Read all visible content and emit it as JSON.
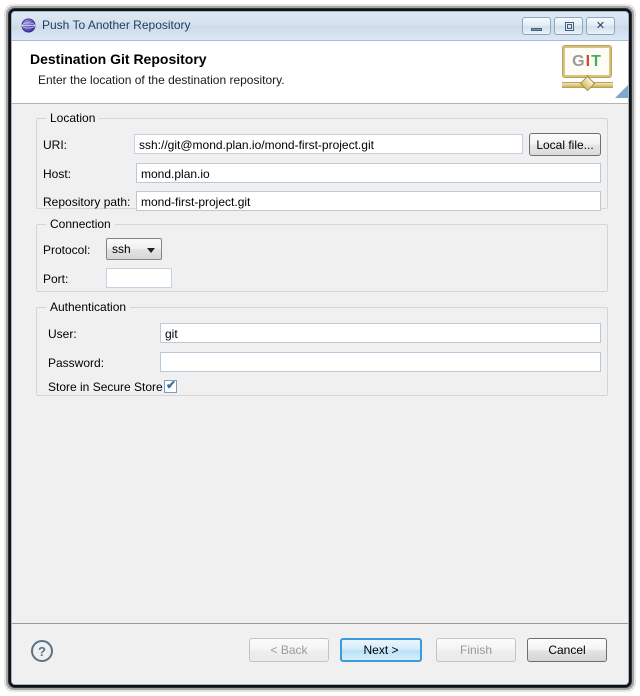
{
  "window": {
    "title": "Push To Another Repository",
    "icon": "globe-icon",
    "controls": {
      "minimize": "minimize-button",
      "maximize": "maximize-button",
      "close_glyph": "✕"
    }
  },
  "header": {
    "title": "Destination Git Repository",
    "description": "Enter the location of the destination repository.",
    "logo": {
      "g": "G",
      "i": "I",
      "t": "T"
    }
  },
  "groups": {
    "location": {
      "label": "Location",
      "uri": {
        "label": "URI:",
        "value": "ssh://git@mond.plan.io/mond-first-project.git"
      },
      "host": {
        "label": "Host:",
        "value": "mond.plan.io"
      },
      "repository_path": {
        "label": "Repository path:",
        "value": "mond-first-project.git"
      },
      "local_file_button": "Local file..."
    },
    "connection": {
      "label": "Connection",
      "protocol": {
        "label": "Protocol:",
        "value": "ssh"
      },
      "port": {
        "label": "Port:",
        "value": ""
      }
    },
    "authentication": {
      "label": "Authentication",
      "user": {
        "label": "User:",
        "value": "git"
      },
      "password": {
        "label": "Password:",
        "value": ""
      },
      "store_secure": {
        "label": "Store in Secure Store",
        "checked": true,
        "mark": "✔"
      }
    }
  },
  "footer": {
    "help_glyph": "?",
    "back": "< Back",
    "next": "Next >",
    "finish": "Finish",
    "cancel": "Cancel"
  },
  "colors": {
    "accent_focus": "#3c9bdc",
    "body_bg": "#f0f0f0",
    "titlebar_text": "#1f3d5c",
    "logo_g": "#9a9a9a",
    "logo_i": "#d9443a",
    "logo_t": "#45b05c",
    "checkbox_mark": "#3a6ea5"
  }
}
